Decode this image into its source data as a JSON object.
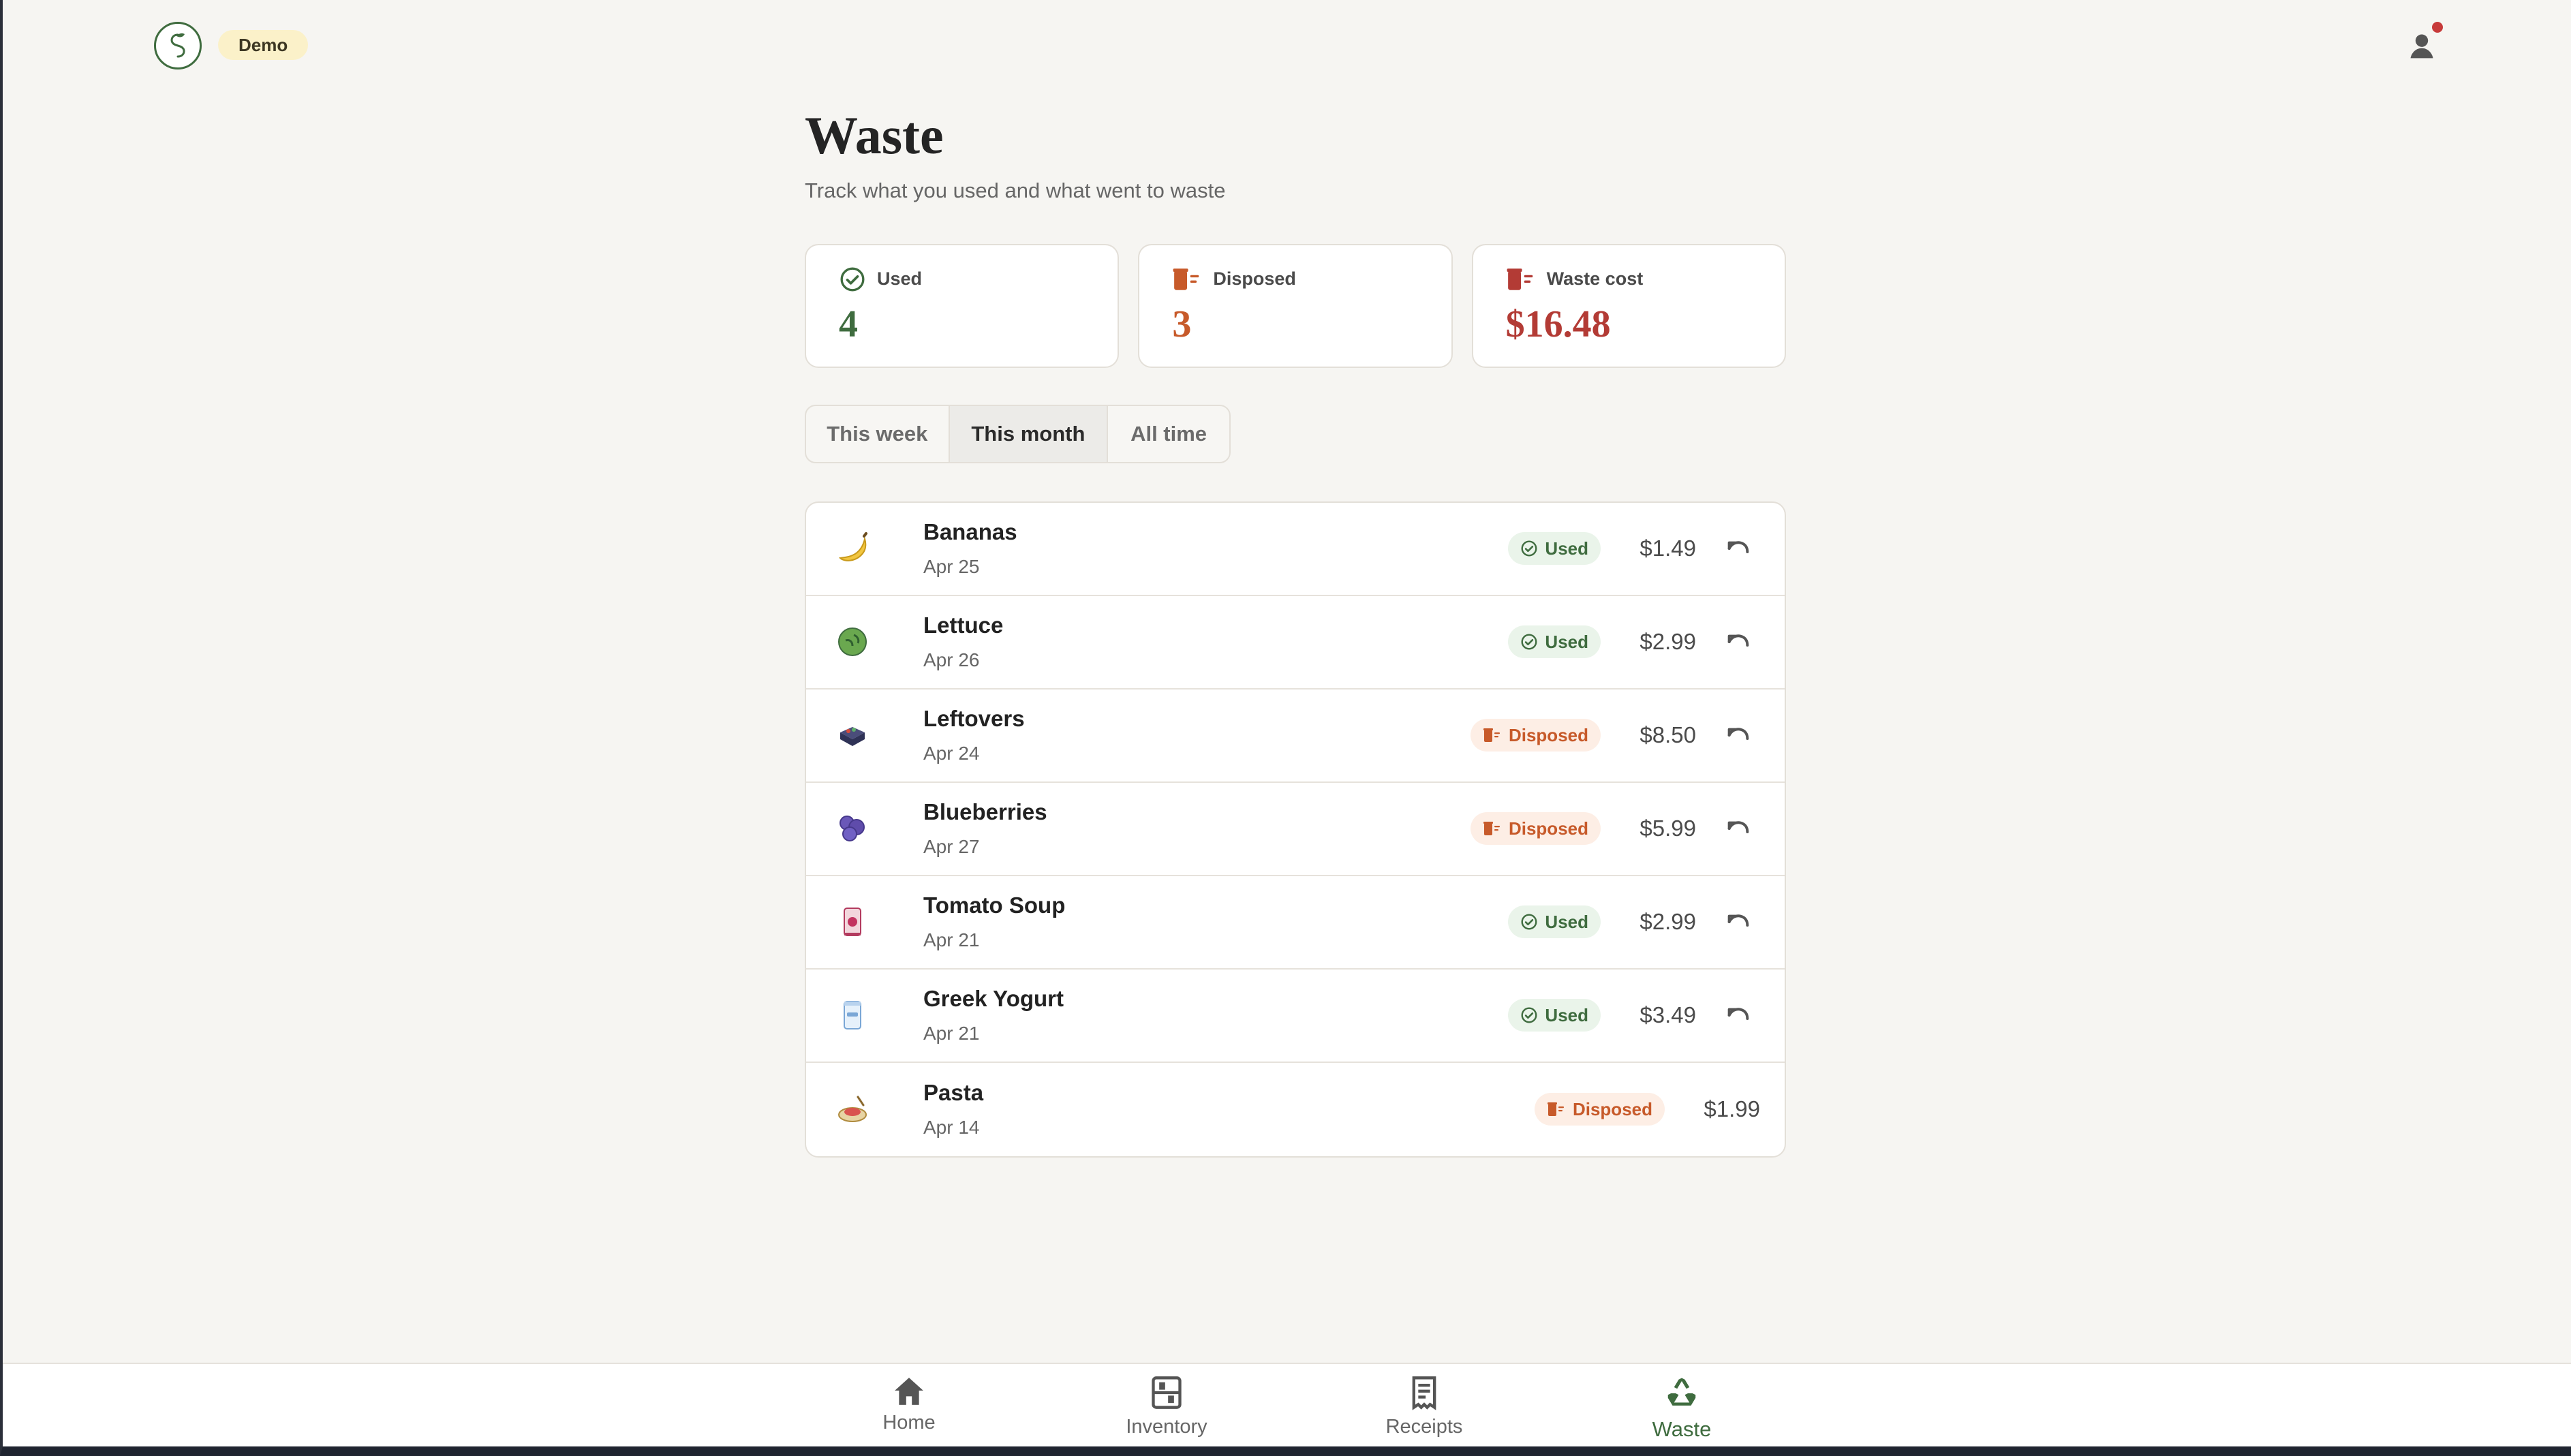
{
  "header": {
    "badge": "Demo",
    "logo_icon": "seed-logo-icon",
    "profile_icon": "user-icon",
    "notification_color": "#c73a3a"
  },
  "page": {
    "title": "Waste",
    "subtitle": "Track what you used and what went to waste"
  },
  "stats": [
    {
      "label": "Used",
      "value": "4",
      "icon": "check-circle-icon",
      "color": "#3f6c3f"
    },
    {
      "label": "Disposed",
      "value": "3",
      "icon": "trash-icon",
      "color": "#c75a2a"
    },
    {
      "label": "Waste cost",
      "value": "$16.48",
      "icon": "trash-icon",
      "color": "#b33b35"
    }
  ],
  "tabs": [
    {
      "label": "This week",
      "selected": false
    },
    {
      "label": "This month",
      "selected": true
    },
    {
      "label": "All time",
      "selected": false
    }
  ],
  "items": [
    {
      "name": "Bananas",
      "date": "Apr 25",
      "status": "Used",
      "price": "$1.49",
      "icon": "banana-icon",
      "undo": true
    },
    {
      "name": "Lettuce",
      "date": "Apr 26",
      "status": "Used",
      "price": "$2.99",
      "icon": "lettuce-icon",
      "undo": true
    },
    {
      "name": "Leftovers",
      "date": "Apr 24",
      "status": "Disposed",
      "price": "$8.50",
      "icon": "leftovers-icon",
      "undo": true
    },
    {
      "name": "Blueberries",
      "date": "Apr 27",
      "status": "Disposed",
      "price": "$5.99",
      "icon": "blueberries-icon",
      "undo": true
    },
    {
      "name": "Tomato Soup",
      "date": "Apr 21",
      "status": "Used",
      "price": "$2.99",
      "icon": "tomato-soup-icon",
      "undo": true
    },
    {
      "name": "Greek Yogurt",
      "date": "Apr 21",
      "status": "Used",
      "price": "$3.49",
      "icon": "greek-yogurt-icon",
      "undo": true
    },
    {
      "name": "Pasta",
      "date": "Apr 14",
      "status": "Disposed",
      "price": "$1.99",
      "icon": "pasta-icon",
      "undo": false
    }
  ],
  "bottom_nav": [
    {
      "label": "Home",
      "icon": "home-icon",
      "active": false
    },
    {
      "label": "Inventory",
      "icon": "inventory-icon",
      "active": false
    },
    {
      "label": "Receipts",
      "icon": "receipts-icon",
      "active": false
    },
    {
      "label": "Waste",
      "icon": "recycle-icon",
      "active": true
    }
  ]
}
